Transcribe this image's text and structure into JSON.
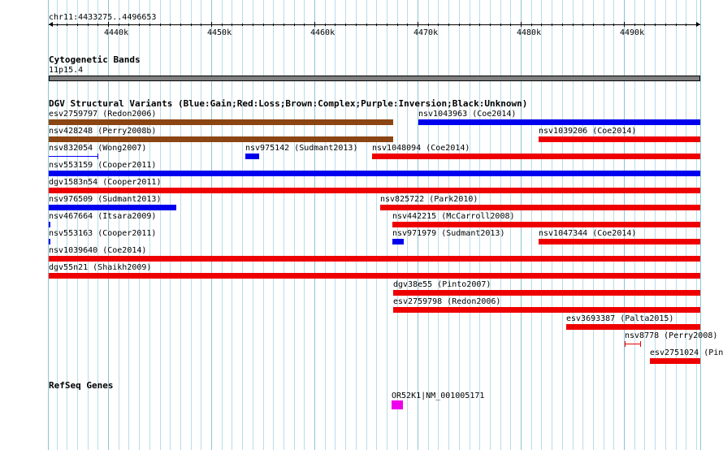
{
  "ruler": {
    "coords": "chr11:4433275..4496653",
    "ticks": [
      "4440k",
      "4450k",
      "4460k",
      "4470k",
      "4480k",
      "4490k"
    ]
  },
  "cytoband": {
    "title": "Cytogenetic Bands",
    "band": "11p15.4"
  },
  "dgv": {
    "title": "DGV Structural Variants (Blue:Gain;Red:Loss;Brown:Complex;Purple:Inversion;Black:Unknown)",
    "features": [
      {
        "label": "esv2759797 (Redon2006)",
        "color": "#8b4513"
      },
      {
        "label": "nsv1043963 (Coe2014)",
        "color": "#0000ee"
      },
      {
        "label": "nsv428248 (Perry2008b)",
        "color": "#8b4513"
      },
      {
        "label": "nsv1039206 (Coe2014)",
        "color": "#ee0000"
      },
      {
        "label": "nsv832054 (Wong2007)",
        "color": "#0000ee"
      },
      {
        "label": "nsv975142 (Sudmant2013)",
        "color": "#0000ee"
      },
      {
        "label": "nsv1048094 (Coe2014)",
        "color": "#ee0000"
      },
      {
        "label": "nsv553159 (Cooper2011)",
        "color": "#0000ee"
      },
      {
        "label": "dgv1583n54 (Cooper2011)",
        "color": "#ee0000"
      },
      {
        "label": "nsv976509 (Sudmant2013)",
        "color": "#0000ee"
      },
      {
        "label": "nsv825722 (Park2010)",
        "color": "#ee0000"
      },
      {
        "label": "nsv467664 (Itsara2009)",
        "color": "#0000ee"
      },
      {
        "label": "nsv442215 (McCarroll2008)",
        "color": "#ee0000"
      },
      {
        "label": "nsv553163 (Cooper2011)",
        "color": "#0000ee"
      },
      {
        "label": "nsv971979 (Sudmant2013)",
        "color": "#0000ee"
      },
      {
        "label": "nsv1047344 (Coe2014)",
        "color": "#ee0000"
      },
      {
        "label": "nsv1039640 (Coe2014)",
        "color": "#ee0000"
      },
      {
        "label": "dgv55n21 (Shaikh2009)",
        "color": "#ee0000"
      },
      {
        "label": "dgv38e55 (Pinto2007)",
        "color": "#ee0000"
      },
      {
        "label": "esv2759798 (Redon2006)",
        "color": "#ee0000"
      },
      {
        "label": "esv3693387 (Palta2015)",
        "color": "#ee0000"
      },
      {
        "label": "nsv8778 (Perry2008)",
        "color": "#ee0000"
      },
      {
        "label": "esv2751024 (Pin",
        "color": "#ee0000"
      }
    ]
  },
  "refseq": {
    "title": "RefSeq Genes",
    "gene": {
      "label": "OR52K1|NM_001005171",
      "color": "#ee00ee"
    }
  }
}
